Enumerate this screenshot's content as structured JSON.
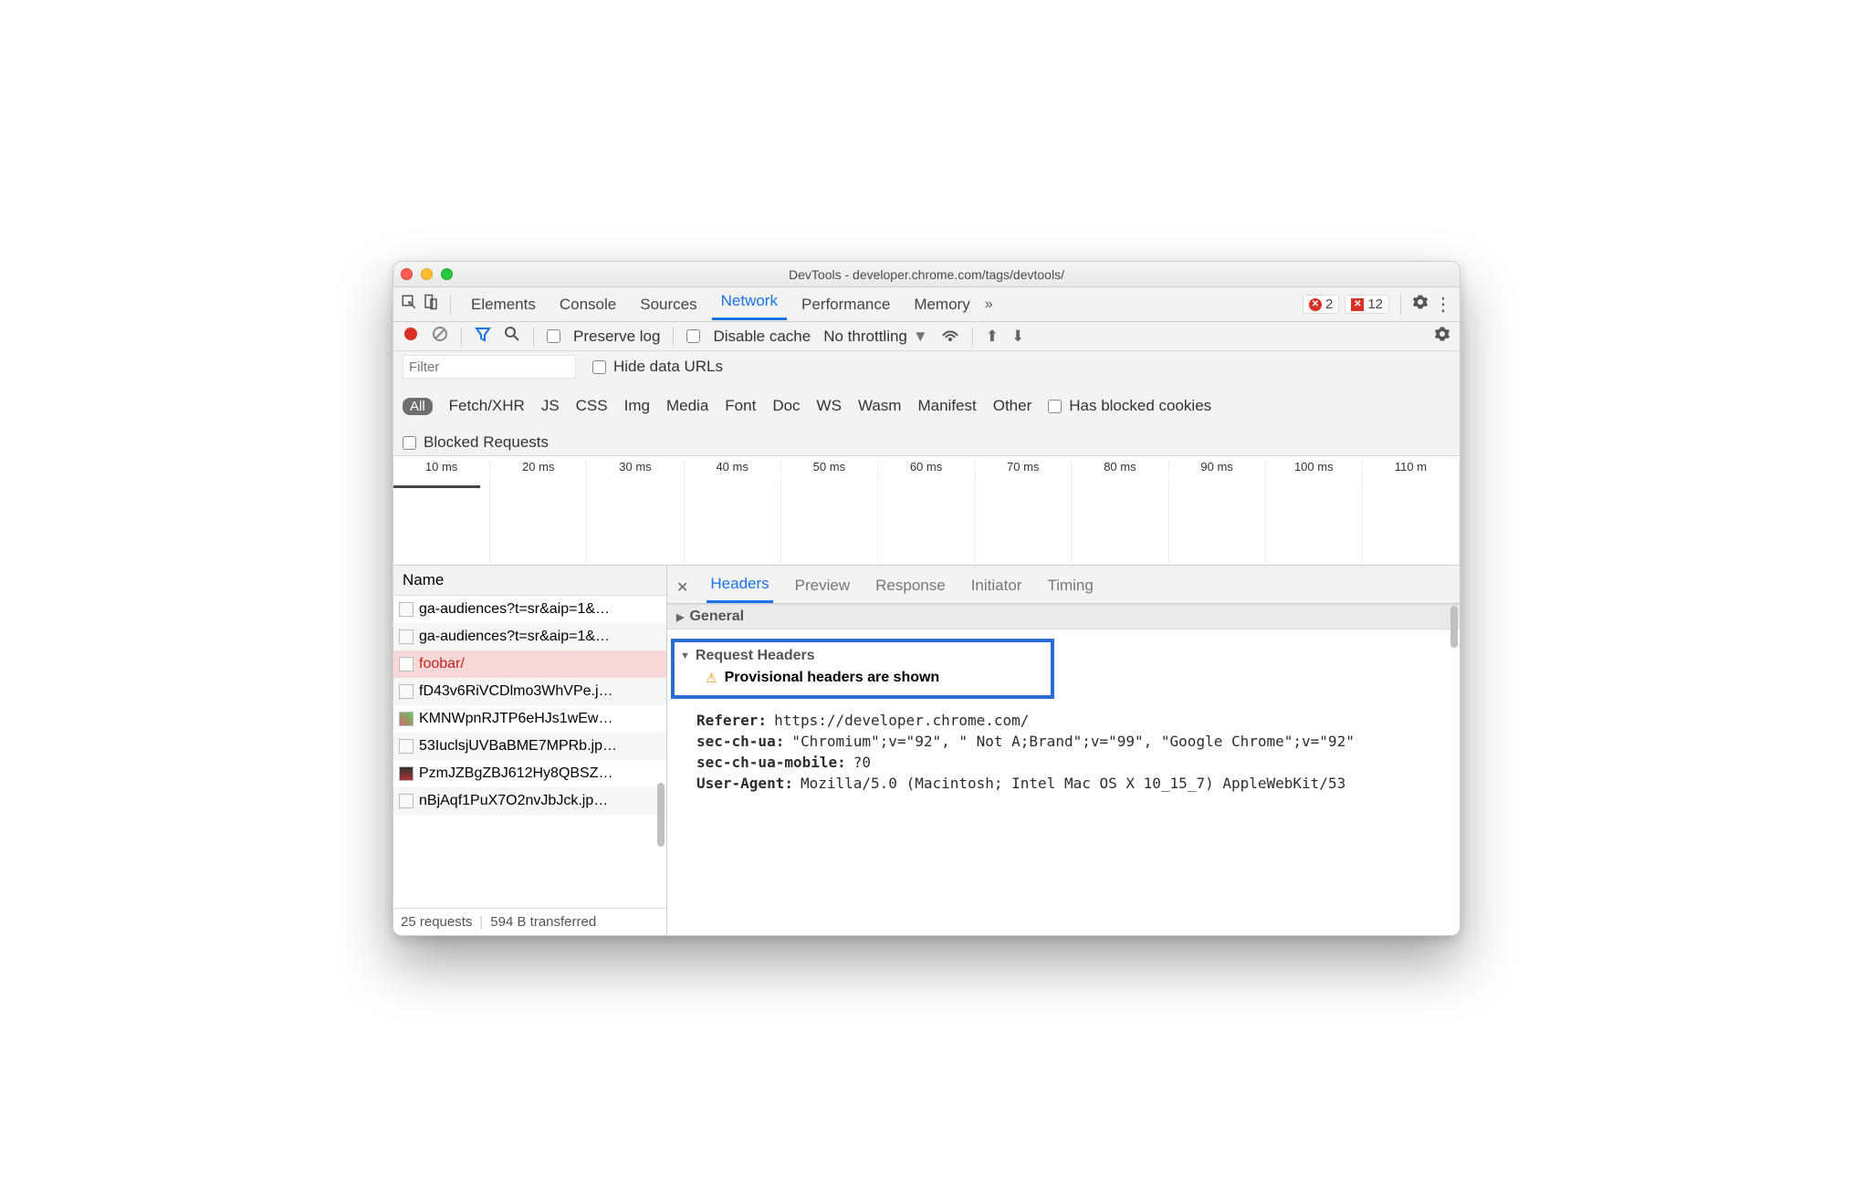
{
  "window": {
    "title": "DevTools - developer.chrome.com/tags/devtools/"
  },
  "tabs": {
    "items": [
      "Elements",
      "Console",
      "Sources",
      "Network",
      "Performance",
      "Memory"
    ],
    "active": "Network",
    "overflow_glyph": "»",
    "error_badge": {
      "count": "2"
    },
    "issue_badge": {
      "count": "12"
    }
  },
  "toolbar": {
    "preserve_log": "Preserve log",
    "disable_cache": "Disable cache",
    "throttling": "No throttling"
  },
  "filter": {
    "placeholder": "Filter",
    "hide_data_urls": "Hide data URLs",
    "types": [
      "All",
      "Fetch/XHR",
      "JS",
      "CSS",
      "Img",
      "Media",
      "Font",
      "Doc",
      "WS",
      "Wasm",
      "Manifest",
      "Other"
    ],
    "has_blocked_cookies": "Has blocked cookies",
    "blocked_requests": "Blocked Requests"
  },
  "waterfall": {
    "ticks": [
      "10 ms",
      "20 ms",
      "30 ms",
      "40 ms",
      "50 ms",
      "60 ms",
      "70 ms",
      "80 ms",
      "90 ms",
      "100 ms",
      "110 m"
    ]
  },
  "list": {
    "header": "Name",
    "items": [
      {
        "name": "ga-audiences?t=sr&aip=1&…",
        "alt": false
      },
      {
        "name": "ga-audiences?t=sr&aip=1&…",
        "alt": true
      },
      {
        "name": "foobar/",
        "sel": true
      },
      {
        "name": "fD43v6RiVCDlmo3WhVPe.j…",
        "alt": true
      },
      {
        "name": "KMNWpnRJTP6eHJs1wEw…",
        "thumb": "img1"
      },
      {
        "name": "53IuclsjUVBaBME7MPRb.jp…",
        "alt": true
      },
      {
        "name": "PzmJZBgZBJ612Hy8QBSZ…",
        "thumb": "img2"
      },
      {
        "name": "nBjAqf1PuX7O2nvJbJck.jp…",
        "alt": true
      }
    ],
    "footer": {
      "requests": "25 requests",
      "transferred": "594 B transferred"
    }
  },
  "details": {
    "tabs": [
      "Headers",
      "Preview",
      "Response",
      "Initiator",
      "Timing"
    ],
    "active": "Headers",
    "general_title": "General",
    "request_headers_title": "Request Headers",
    "provisional": "Provisional headers are shown",
    "headers": [
      {
        "k": "Referer:",
        "v": "https://developer.chrome.com/"
      },
      {
        "k": "sec-ch-ua:",
        "v": "\"Chromium\";v=\"92\", \" Not A;Brand\";v=\"99\", \"Google Chrome\";v=\"92\""
      },
      {
        "k": "sec-ch-ua-mobile:",
        "v": "?0"
      },
      {
        "k": "User-Agent:",
        "v": "Mozilla/5.0 (Macintosh; Intel Mac OS X 10_15_7) AppleWebKit/53"
      }
    ]
  }
}
